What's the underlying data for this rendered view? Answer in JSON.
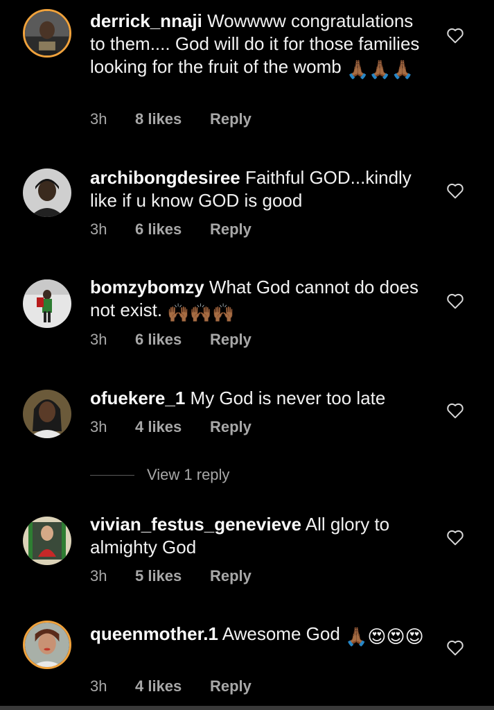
{
  "comments": [
    {
      "username": "derrick_nnaji",
      "text": " Wowwww congratulations to them.... God will do it for those families looking for the fruit of the womb ",
      "emoji": "🙏🏾🙏🏾🙏🏾",
      "time": "3h",
      "likes": "8 likes",
      "reply": "Reply",
      "has_story_ring": true
    },
    {
      "username": "archibongdesiree",
      "text": " Faithful GOD...kindly like if u know GOD is good",
      "emoji": "",
      "time": "3h",
      "likes": "6 likes",
      "reply": "Reply",
      "has_story_ring": false
    },
    {
      "username": "bomzybomzy",
      "text": " What God cannot do does not exist. ",
      "emoji": "🙌🏾🙌🏾🙌🏾",
      "time": "3h",
      "likes": "6 likes",
      "reply": "Reply",
      "has_story_ring": false
    },
    {
      "username": "ofuekere_1",
      "text": " My God is never too late",
      "emoji": "",
      "time": "3h",
      "likes": "4 likes",
      "reply": "Reply",
      "has_story_ring": false
    },
    {
      "username": "vivian_festus_genevieve",
      "text": " All glory to almighty God",
      "emoji": "",
      "time": "3h",
      "likes": "5 likes",
      "reply": "Reply",
      "has_story_ring": false
    },
    {
      "username": "queenmother.1",
      "text": " Awesome God ",
      "emoji": "🙏🏾😍😍😍",
      "time": "3h",
      "likes": "4 likes",
      "reply": "Reply",
      "has_story_ring": true
    }
  ],
  "view_replies": "View 1 reply",
  "icons": {
    "like": "heart-outline-icon"
  },
  "colors": {
    "background": "#000000",
    "text": "#f2f2f2",
    "meta": "#a8a8a8",
    "story_ring": "#f0a23c"
  }
}
